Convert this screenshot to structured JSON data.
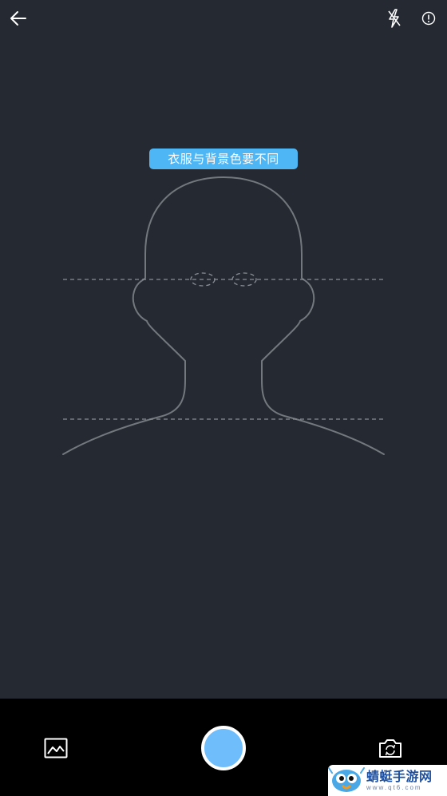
{
  "camera": {
    "tip_text": "衣服与背景色要不同"
  },
  "watermark": {
    "name": "蜻蜓手游网",
    "url": "www.qt6.com"
  },
  "icons": {
    "back": "arrow-left-icon",
    "flash": "flash-off-icon",
    "info": "info-icon",
    "gallery": "gallery-icon",
    "switch_camera": "switch-camera-icon"
  },
  "colors": {
    "background": "#252a32",
    "accent": "#4fb6f6",
    "shutter": "#70bdfb",
    "bottom_bar": "#000000"
  }
}
